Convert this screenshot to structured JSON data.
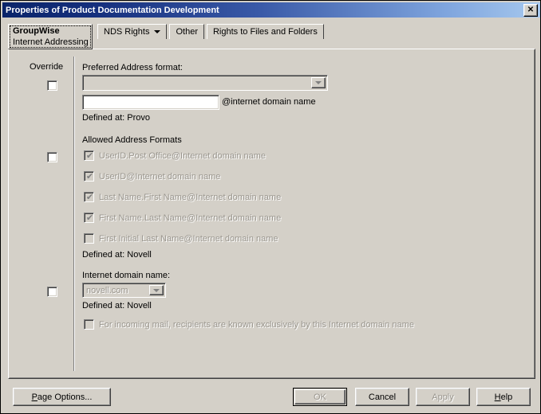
{
  "window": {
    "title": "Properties of Product Documentation Development",
    "close_label": "✕"
  },
  "tabs": {
    "active": {
      "primary": "GroupWise",
      "secondary": "Internet Addressing",
      "caret": "chevron-down-icon"
    },
    "others": [
      {
        "label": "NDS Rights",
        "has_caret": true
      },
      {
        "label": "Other",
        "has_caret": false
      },
      {
        "label": "Rights to Files and Folders",
        "has_caret": false
      }
    ]
  },
  "panel": {
    "override_header": "Override",
    "preferred_address_format": {
      "label": "Preferred Address format:",
      "combo_value": "",
      "domain_input_value": "",
      "domain_input_placeholder": "",
      "suffix_label": "@internet domain name",
      "defined_at": "Defined at:  Provo",
      "override_checked": false
    },
    "allowed_address_formats": {
      "label": "Allowed Address Formats",
      "override_checked": false,
      "items": [
        {
          "label": "UserID.Post Office@Internet domain name",
          "checked": true
        },
        {
          "label": "UserID@Internet domain name",
          "checked": true
        },
        {
          "label": "Last Name.First Name@Internet domain name",
          "checked": true
        },
        {
          "label": "First Name.Last Name@Internet domain name",
          "checked": true
        },
        {
          "label": "First Initial Last Name@Internet domain name",
          "checked": false
        }
      ],
      "defined_at": "Defined at:  Novell"
    },
    "internet_domain_name": {
      "label": "Internet domain name:",
      "combo_value": "novell.com",
      "defined_at": "Defined at:  Novell",
      "override_checked": false,
      "exclusive_checkbox": {
        "label": "For incoming mail, recipients are known exclusively by this Internet domain name",
        "checked": false
      }
    }
  },
  "footer": {
    "page_options": {
      "prefix": "P",
      "rest": "age Options..."
    },
    "ok": "OK",
    "cancel": "Cancel",
    "apply": "Apply",
    "help": {
      "prefix": "H",
      "rest": "elp"
    }
  },
  "colors": {
    "face": "#d4d0c8",
    "title_left": "#0a246a",
    "title_right": "#a6c8ee",
    "disabled_text": "#9a968e"
  },
  "icons": {
    "close": "close-icon",
    "checkmark": "✔"
  }
}
